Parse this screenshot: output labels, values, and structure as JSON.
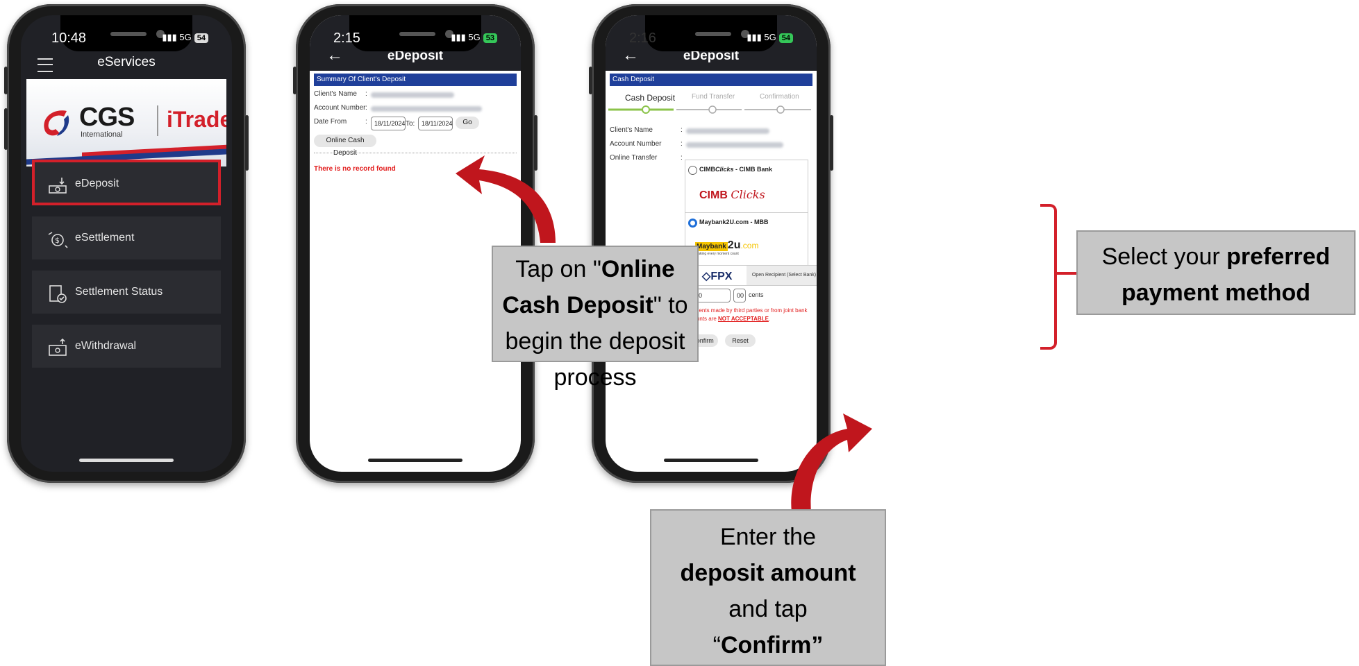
{
  "phone1": {
    "status_time": "10:48",
    "status_net": "5G",
    "status_batt": "54",
    "title": "eServices",
    "banner": {
      "brand": "CGS",
      "sub": "International",
      "product": "iTrade"
    },
    "menu": [
      {
        "label": "eDeposit",
        "icon": "deposit-icon"
      },
      {
        "label": "eSettlement",
        "icon": "settlement-icon"
      },
      {
        "label": "Settlement Status",
        "icon": "status-icon"
      },
      {
        "label": "eWithdrawal",
        "icon": "withdraw-icon"
      }
    ]
  },
  "phone2": {
    "status_time": "2:15",
    "status_net": "5G",
    "status_batt": "53",
    "title": "eDeposit",
    "section_title": "Summary Of Client's Deposit",
    "labels": {
      "client_name": "Client's Name",
      "account_number": "Account Number",
      "date_from": "Date From",
      "to": "To:"
    },
    "sep": ":",
    "date_from_value": "18/11/2024",
    "date_to_value": "18/11/2024",
    "go_button": "Go",
    "online_cash_button": "Online Cash Deposit",
    "no_record": "There is no record found"
  },
  "phone3": {
    "status_time": "2:16",
    "status_net": "5G",
    "status_batt": "54",
    "title": "eDeposit",
    "section_title": "Cash Deposit",
    "steps": [
      "Cash Deposit",
      "Fund Transfer",
      "Confirmation"
    ],
    "labels": {
      "client_name": "Client's Name",
      "account_number": "Account Number",
      "online_transfer": "Online Transfer",
      "amount": "ount"
    },
    "sep": ":",
    "options": [
      {
        "label_pre": "CIMB",
        "label_italic": "Clicks",
        "label_post": " - CIMB Bank",
        "logo_a": "CIMB",
        "logo_b": "Clicks",
        "selected": false
      },
      {
        "label": "Maybank2U.com - MBB",
        "logo_a": "Maybank",
        "logo_b": "2u",
        "logo_c": ".com",
        "logo_tag": "making every moment count",
        "selected": true
      },
      {
        "label": "FPX",
        "button": "Open Recipient (Select Bank)",
        "selected": false
      }
    ],
    "amount_value": "1000",
    "cents_value": "00",
    "cents_label": "cents",
    "warning_text": "Payments made by third parties or from joint bank accounts are ",
    "warning_emph": "NOT ACCEPTABLE",
    "warning_end": ".",
    "confirm_button": "Confirm",
    "reset_button": "Reset"
  },
  "callouts": {
    "online_cash": {
      "t1": "Tap on \"",
      "b1": "Online Cash Deposit",
      "t2": "\" to begin the deposit process"
    },
    "amount": {
      "t1": "Enter the",
      "b1": "deposit amount",
      "t2": "and tap",
      "q1": "“",
      "b2": "Confirm”"
    },
    "payment": {
      "t1": "Select your ",
      "b1": "preferred payment method"
    }
  },
  "colors": {
    "accent_red": "#d3202a",
    "band_blue": "#1f3f9a",
    "dark_bg": "#202126",
    "callout_grey": "#c6c6c6"
  }
}
